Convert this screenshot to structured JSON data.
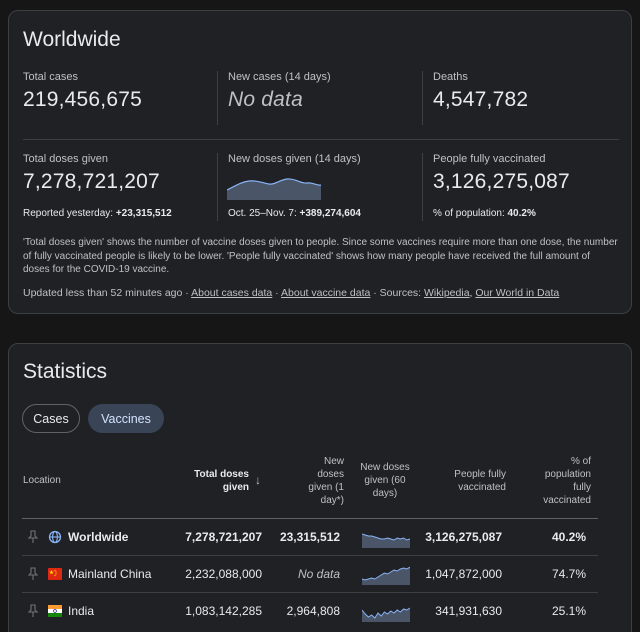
{
  "worldwide": {
    "title": "Worldwide",
    "total_cases": {
      "label": "Total cases",
      "value": "219,456,675"
    },
    "new_cases": {
      "label": "New cases (14 days)",
      "value": "No data"
    },
    "deaths": {
      "label": "Deaths",
      "value": "4,547,782"
    },
    "total_doses": {
      "label": "Total doses given",
      "value": "7,278,721,207",
      "sub_prefix": "Reported yesterday: ",
      "sub_value": "+23,315,512"
    },
    "new_doses": {
      "label": "New doses given (14 days)",
      "sub_prefix": "Oct. 25–Nov. 7: ",
      "sub_value": "+389,274,604"
    },
    "fully_vaccinated": {
      "label": "People fully vaccinated",
      "value": "3,126,275,087",
      "sub_prefix": "% of population: ",
      "sub_value": "40.2%"
    },
    "description": "'Total doses given' shows the number of vaccine doses given to people. Since some vaccines require more than one dose, the number of fully vaccinated people is likely to be lower. 'People fully vaccinated' shows how many people have received the full amount of doses for the COVID-19 vaccine.",
    "updated": {
      "prefix": "Updated less than 52 minutes ago · ",
      "link_cases": "About cases data",
      "sep1": " · ",
      "link_vaccine": "About vaccine data",
      "sources_prefix": " · Sources: ",
      "link_wikipedia": "Wikipedia",
      "comma": ", ",
      "link_owid": "Our World in Data"
    }
  },
  "statistics": {
    "title": "Statistics",
    "tabs": {
      "cases": "Cases",
      "vaccines": "Vaccines"
    },
    "headers": {
      "location": "Location",
      "total_doses_l1": "Total doses",
      "total_doses_l2": "given",
      "sort_arrow": "↓",
      "new_doses_1day_l1": "New",
      "new_doses_1day_l2": "doses",
      "new_doses_1day_l3": "given (1",
      "new_doses_1day_l4": "day*)",
      "new_doses_60_l1": "New doses",
      "new_doses_60_l2": "given (60",
      "new_doses_60_l3": "days)",
      "fully_l1": "People fully",
      "fully_l2": "vaccinated",
      "pct_l1": "% of",
      "pct_l2": "population",
      "pct_l3": "fully",
      "pct_l4": "vaccinated"
    },
    "rows": [
      {
        "location": "Worldwide",
        "total": "7,278,721,207",
        "new_1day": "23,315,512",
        "fully": "3,126,275,087",
        "pct": "40.2%",
        "icon": "globe-icon",
        "spark": [
          14,
          13,
          12,
          12,
          11,
          10,
          9,
          9,
          10,
          9,
          8,
          10,
          9,
          10,
          8,
          9
        ]
      },
      {
        "location": "Mainland China",
        "total": "2,232,088,000",
        "new_1day": "No data",
        "fully": "1,047,872,000",
        "pct": "74.7%",
        "icon": "china-flag-icon",
        "spark": [
          6,
          5,
          6,
          7,
          6,
          8,
          10,
          12,
          11,
          13,
          15,
          14,
          16,
          17,
          16,
          18
        ]
      },
      {
        "location": "India",
        "total": "1,083,142,285",
        "new_1day": "2,964,808",
        "fully": "341,931,630",
        "pct": "25.1%",
        "icon": "india-flag-icon",
        "spark": [
          12,
          8,
          5,
          7,
          4,
          9,
          6,
          10,
          8,
          11,
          9,
          12,
          10,
          13,
          12,
          14
        ]
      }
    ]
  },
  "colors": {
    "card_bg": "#202124",
    "accent_chip": "#394457",
    "spark_fill": "#4a5568",
    "spark_line": "#8ab4f8"
  }
}
